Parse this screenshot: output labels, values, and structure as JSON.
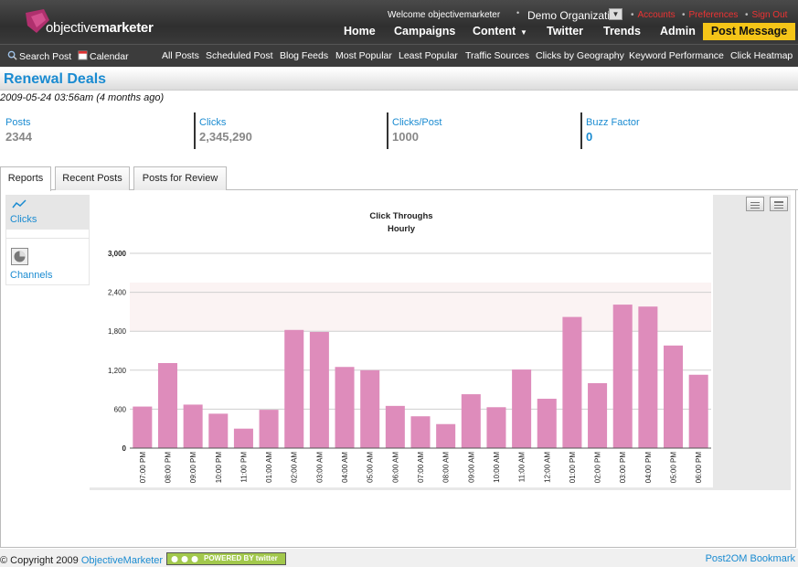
{
  "header": {
    "logo_plain": "objective",
    "logo_bold": "marketer",
    "welcome": "Welcome objectivemarketer",
    "organization": "Demo Organization",
    "top_links": [
      "Accounts",
      "Preferences",
      "Sign Out"
    ],
    "nav": [
      "Home",
      "Campaigns",
      "Content",
      "Twitter",
      "Trends",
      "Admin"
    ],
    "post_message": "Post Message",
    "accent_color": "#f5c518"
  },
  "subnav": {
    "search_post": "Search Post",
    "calendar": "Calendar",
    "items": [
      "All Posts",
      "Scheduled Post",
      "Blog Feeds",
      "Most Popular",
      "Least Popular",
      "Traffic Sources",
      "Clicks by Geography",
      "Keyword Performance",
      "Click Heatmap"
    ]
  },
  "page": {
    "title": "Renewal Deals",
    "timestamp": "2009-05-24 03:56am (4 months ago)"
  },
  "stats": [
    {
      "label": "Posts",
      "value": "2344"
    },
    {
      "label": "Clicks",
      "value": "2,345,290"
    },
    {
      "label": "Clicks/Post",
      "value": "1000"
    },
    {
      "label": "Buzz Factor",
      "value": "0"
    }
  ],
  "tabs": [
    "Reports",
    "Recent Posts",
    "Posts for Review"
  ],
  "side_menu": [
    "Clicks",
    "Channels"
  ],
  "chart_data": {
    "type": "bar",
    "title": "Click Throughs",
    "subtitle": "Hourly",
    "categories": [
      "07:00 PM",
      "08:00 PM",
      "09:00 PM",
      "10:00 PM",
      "11:00 PM",
      "01:00 AM",
      "02:00 AM",
      "03:00 AM",
      "04:00 AM",
      "05:00 AM",
      "06:00 AM",
      "07:00 AM",
      "08:00 AM",
      "09:00 AM",
      "10:00 AM",
      "11:00 AM",
      "12:00 AM",
      "01:00 PM",
      "02:00 PM",
      "03:00 PM",
      "04:00 PM",
      "05:00 PM",
      "06:00 PM"
    ],
    "values": [
      640,
      1310,
      670,
      530,
      300,
      590,
      1820,
      1790,
      1250,
      1200,
      650,
      490,
      370,
      830,
      630,
      1210,
      760,
      2020,
      1000,
      2210,
      2180,
      1580,
      1130
    ],
    "y_ticks": [
      "0",
      "600",
      "1,200",
      "1,800",
      "2,400",
      "3,000"
    ],
    "ylim": [
      0,
      3000
    ],
    "bar_color": "#de8cbb",
    "band_color": "#fbf3f3",
    "grid": true
  },
  "footer": {
    "copyright_prefix": "© Copyright 2009",
    "company": "ObjectiveMarketer",
    "badge": "POWERED BY twitter",
    "bookmark": "Post2OM Bookmark"
  }
}
